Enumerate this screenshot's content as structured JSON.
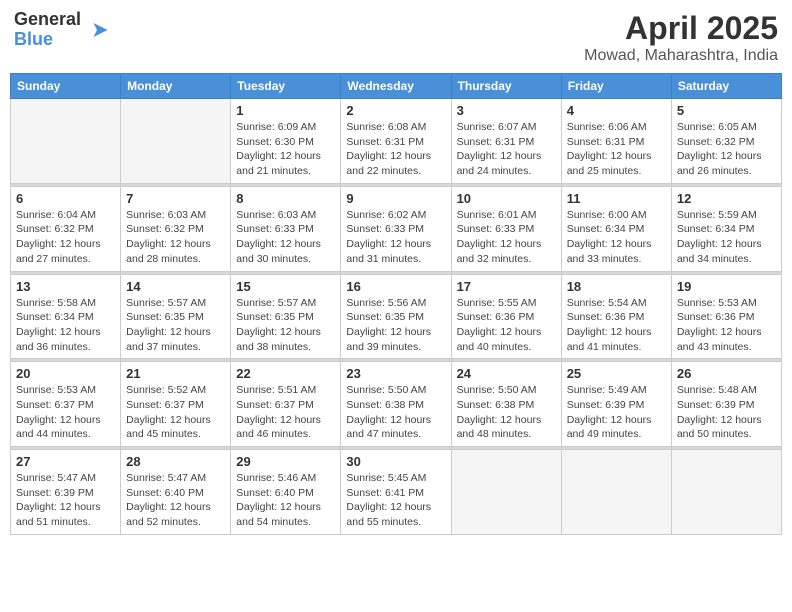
{
  "header": {
    "logo_line1": "General",
    "logo_line2": "Blue",
    "month": "April 2025",
    "location": "Mowad, Maharashtra, India"
  },
  "weekdays": [
    "Sunday",
    "Monday",
    "Tuesday",
    "Wednesday",
    "Thursday",
    "Friday",
    "Saturday"
  ],
  "weeks": [
    [
      {
        "day": "",
        "info": ""
      },
      {
        "day": "",
        "info": ""
      },
      {
        "day": "1",
        "info": "Sunrise: 6:09 AM\nSunset: 6:30 PM\nDaylight: 12 hours\nand 21 minutes."
      },
      {
        "day": "2",
        "info": "Sunrise: 6:08 AM\nSunset: 6:31 PM\nDaylight: 12 hours\nand 22 minutes."
      },
      {
        "day": "3",
        "info": "Sunrise: 6:07 AM\nSunset: 6:31 PM\nDaylight: 12 hours\nand 24 minutes."
      },
      {
        "day": "4",
        "info": "Sunrise: 6:06 AM\nSunset: 6:31 PM\nDaylight: 12 hours\nand 25 minutes."
      },
      {
        "day": "5",
        "info": "Sunrise: 6:05 AM\nSunset: 6:32 PM\nDaylight: 12 hours\nand 26 minutes."
      }
    ],
    [
      {
        "day": "6",
        "info": "Sunrise: 6:04 AM\nSunset: 6:32 PM\nDaylight: 12 hours\nand 27 minutes."
      },
      {
        "day": "7",
        "info": "Sunrise: 6:03 AM\nSunset: 6:32 PM\nDaylight: 12 hours\nand 28 minutes."
      },
      {
        "day": "8",
        "info": "Sunrise: 6:03 AM\nSunset: 6:33 PM\nDaylight: 12 hours\nand 30 minutes."
      },
      {
        "day": "9",
        "info": "Sunrise: 6:02 AM\nSunset: 6:33 PM\nDaylight: 12 hours\nand 31 minutes."
      },
      {
        "day": "10",
        "info": "Sunrise: 6:01 AM\nSunset: 6:33 PM\nDaylight: 12 hours\nand 32 minutes."
      },
      {
        "day": "11",
        "info": "Sunrise: 6:00 AM\nSunset: 6:34 PM\nDaylight: 12 hours\nand 33 minutes."
      },
      {
        "day": "12",
        "info": "Sunrise: 5:59 AM\nSunset: 6:34 PM\nDaylight: 12 hours\nand 34 minutes."
      }
    ],
    [
      {
        "day": "13",
        "info": "Sunrise: 5:58 AM\nSunset: 6:34 PM\nDaylight: 12 hours\nand 36 minutes."
      },
      {
        "day": "14",
        "info": "Sunrise: 5:57 AM\nSunset: 6:35 PM\nDaylight: 12 hours\nand 37 minutes."
      },
      {
        "day": "15",
        "info": "Sunrise: 5:57 AM\nSunset: 6:35 PM\nDaylight: 12 hours\nand 38 minutes."
      },
      {
        "day": "16",
        "info": "Sunrise: 5:56 AM\nSunset: 6:35 PM\nDaylight: 12 hours\nand 39 minutes."
      },
      {
        "day": "17",
        "info": "Sunrise: 5:55 AM\nSunset: 6:36 PM\nDaylight: 12 hours\nand 40 minutes."
      },
      {
        "day": "18",
        "info": "Sunrise: 5:54 AM\nSunset: 6:36 PM\nDaylight: 12 hours\nand 41 minutes."
      },
      {
        "day": "19",
        "info": "Sunrise: 5:53 AM\nSunset: 6:36 PM\nDaylight: 12 hours\nand 43 minutes."
      }
    ],
    [
      {
        "day": "20",
        "info": "Sunrise: 5:53 AM\nSunset: 6:37 PM\nDaylight: 12 hours\nand 44 minutes."
      },
      {
        "day": "21",
        "info": "Sunrise: 5:52 AM\nSunset: 6:37 PM\nDaylight: 12 hours\nand 45 minutes."
      },
      {
        "day": "22",
        "info": "Sunrise: 5:51 AM\nSunset: 6:37 PM\nDaylight: 12 hours\nand 46 minutes."
      },
      {
        "day": "23",
        "info": "Sunrise: 5:50 AM\nSunset: 6:38 PM\nDaylight: 12 hours\nand 47 minutes."
      },
      {
        "day": "24",
        "info": "Sunrise: 5:50 AM\nSunset: 6:38 PM\nDaylight: 12 hours\nand 48 minutes."
      },
      {
        "day": "25",
        "info": "Sunrise: 5:49 AM\nSunset: 6:39 PM\nDaylight: 12 hours\nand 49 minutes."
      },
      {
        "day": "26",
        "info": "Sunrise: 5:48 AM\nSunset: 6:39 PM\nDaylight: 12 hours\nand 50 minutes."
      }
    ],
    [
      {
        "day": "27",
        "info": "Sunrise: 5:47 AM\nSunset: 6:39 PM\nDaylight: 12 hours\nand 51 minutes."
      },
      {
        "day": "28",
        "info": "Sunrise: 5:47 AM\nSunset: 6:40 PM\nDaylight: 12 hours\nand 52 minutes."
      },
      {
        "day": "29",
        "info": "Sunrise: 5:46 AM\nSunset: 6:40 PM\nDaylight: 12 hours\nand 54 minutes."
      },
      {
        "day": "30",
        "info": "Sunrise: 5:45 AM\nSunset: 6:41 PM\nDaylight: 12 hours\nand 55 minutes."
      },
      {
        "day": "",
        "info": ""
      },
      {
        "day": "",
        "info": ""
      },
      {
        "day": "",
        "info": ""
      }
    ]
  ]
}
